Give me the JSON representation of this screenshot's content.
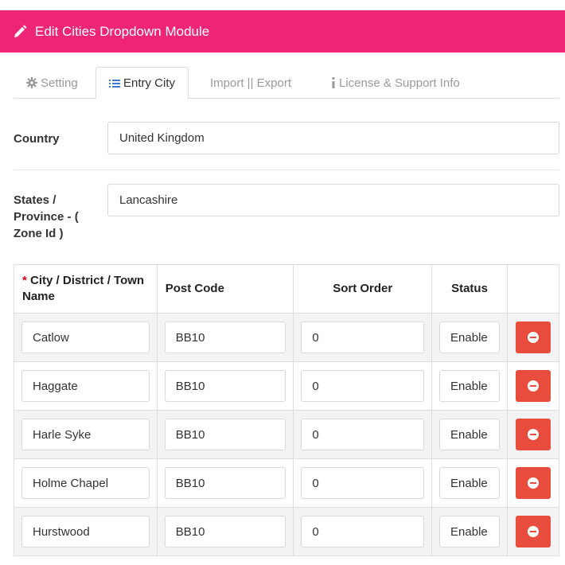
{
  "header": {
    "title": "Edit Cities Dropdown Module"
  },
  "tabs": [
    {
      "label": "Setting",
      "icon": "gear-icon"
    },
    {
      "label": "Entry City",
      "icon": "list-icon",
      "active": true
    },
    {
      "label": "Import || Export"
    },
    {
      "label": "License & Support Info",
      "icon": "info-icon"
    }
  ],
  "form": {
    "country_label": "Country",
    "country_value": "United Kingdom",
    "state_label_1": "States /",
    "state_label_2": "Province - (",
    "state_label_3": "Zone Id )",
    "state_value": "Lancashire"
  },
  "table": {
    "required_mark": "*",
    "headers": {
      "city_1": "City / District / Town",
      "city_2": "Name",
      "postcode": "Post Code",
      "sort_order": "Sort Order",
      "status": "Status"
    },
    "rows": [
      {
        "city": "Catlow",
        "postcode": "BB10",
        "sort_order": "0",
        "status": "Enable"
      },
      {
        "city": "Haggate",
        "postcode": "BB10",
        "sort_order": "0",
        "status": "Enable"
      },
      {
        "city": "Harle Syke",
        "postcode": "BB10",
        "sort_order": "0",
        "status": "Enable"
      },
      {
        "city": "Holme Chapel",
        "postcode": "BB10",
        "sort_order": "0",
        "status": "Enable"
      },
      {
        "city": "Hurstwood",
        "postcode": "BB10",
        "sort_order": "0",
        "status": "Enable"
      }
    ]
  },
  "colors": {
    "header_bg": "#ee2577",
    "delete_button": "#e74c3c",
    "required": "#d0021b"
  }
}
